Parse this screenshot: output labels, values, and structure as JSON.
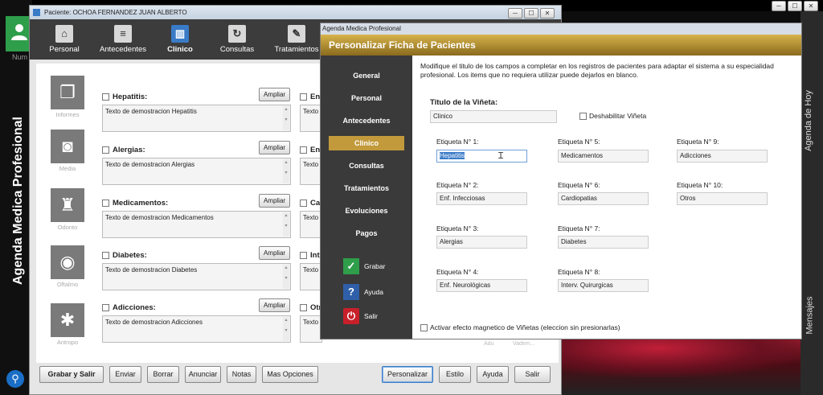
{
  "desktop": {
    "user_label": "Num",
    "side_title": "Agenda Medica Profesional",
    "right_labels": {
      "agenda_hoy": "Agenda de Hoy",
      "mensajes": "Mensajes"
    }
  },
  "patient_window": {
    "title": "Paciente: OCHOA FERNANDEZ JUAN ALBERTO",
    "tabs": [
      {
        "label": "Personal",
        "icon": "house-icon"
      },
      {
        "label": "Antecedentes",
        "icon": "document-icon"
      },
      {
        "label": "Clinico",
        "icon": "bar-chart-icon",
        "active": true
      },
      {
        "label": "Consultas",
        "icon": "refresh-icon"
      },
      {
        "label": "Tratamientos",
        "icon": "notepad-icon"
      }
    ],
    "sections": [
      {
        "caption": "Informes",
        "icon": "documents-icon",
        "label": "Hepatitis:",
        "text": "Texto de demostracion Hepatitis",
        "col2": "Enf",
        "col2_text": "Texto"
      },
      {
        "caption": "Media",
        "icon": "camera-icon",
        "label": "Alergias:",
        "text": "Texto de demostracion Alergias",
        "col2": "Enf",
        "col2_text": "Texto"
      },
      {
        "caption": "Odonto",
        "icon": "tooth-icon",
        "label": "Medicamentos:",
        "text": "Texto de demostracion Medicamentos",
        "col2": "Car",
        "col2_text": "Texto"
      },
      {
        "caption": "Oftalmo",
        "icon": "eye-icon",
        "label": "Diabetes:",
        "text": "Texto de demostracion Diabetes",
        "col2": "Inte",
        "col2_text": "Texto"
      },
      {
        "caption": "Antropo",
        "icon": "vitruvian-icon",
        "label": "Adicciones:",
        "text": "Texto de demostracion Adicciones",
        "col2": "Otr",
        "col2_text": "Texto"
      }
    ],
    "ampliar_label": "Ampliar",
    "faded_text": {
      "a": "Adu",
      "b": "Vadem..."
    },
    "buttons": {
      "grabar_salir": "Grabar y Salir",
      "enviar": "Enviar",
      "borrar": "Borrar",
      "anunciar": "Anunciar",
      "notas": "Notas",
      "mas_opciones": "Mas Opciones",
      "personalizar": "Personalizar",
      "estilo": "Estilo",
      "ayuda": "Ayuda",
      "salir": "Salir"
    }
  },
  "dialog": {
    "window_title": "Agenda Medica Profesional",
    "header": "Personalizar Ficha de Pacientes",
    "nav": [
      "General",
      "Personal",
      "Antecedentes",
      "Clinico",
      "Consultas",
      "Tratamientos",
      "Evoluciones",
      "Pagos"
    ],
    "nav_active": "Clinico",
    "actions": {
      "grabar": "Grabar",
      "ayuda": "Ayuda",
      "salir": "Salir"
    },
    "description": "Modifique el titulo de los campos a completar en los registros de pacientes para adaptar el sistema a su especialidad profesional. Los items que no requiera utilizar puede dejarlos en blanco.",
    "vineta_title": "Titulo de la Viñeta:",
    "vineta_value": "Clinico",
    "disable_label": "Deshabilitar Viñeta",
    "etiquetas": [
      {
        "label": "Etiqueta N° 1:",
        "value": "Hepatitis"
      },
      {
        "label": "Etiqueta N° 2:",
        "value": "Enf. Infecciosas"
      },
      {
        "label": "Etiqueta N° 3:",
        "value": "Alergias"
      },
      {
        "label": "Etiqueta N° 4:",
        "value": "Enf. Neurológicas"
      },
      {
        "label": "Etiqueta N° 5:",
        "value": "Medicamentos"
      },
      {
        "label": "Etiqueta N° 6:",
        "value": "Cardiopatias"
      },
      {
        "label": "Etiqueta N° 7:",
        "value": "Diabetes"
      },
      {
        "label": "Etiqueta N° 8:",
        "value": "Interv. Quirurgicas"
      },
      {
        "label": "Etiqueta N° 9:",
        "value": "Adicciones"
      },
      {
        "label": "Etiqueta N° 10:",
        "value": "Otros"
      }
    ],
    "magnetic_label": "Activar efecto magnetico de Viñetas (eleccion sin presionarlas)"
  }
}
